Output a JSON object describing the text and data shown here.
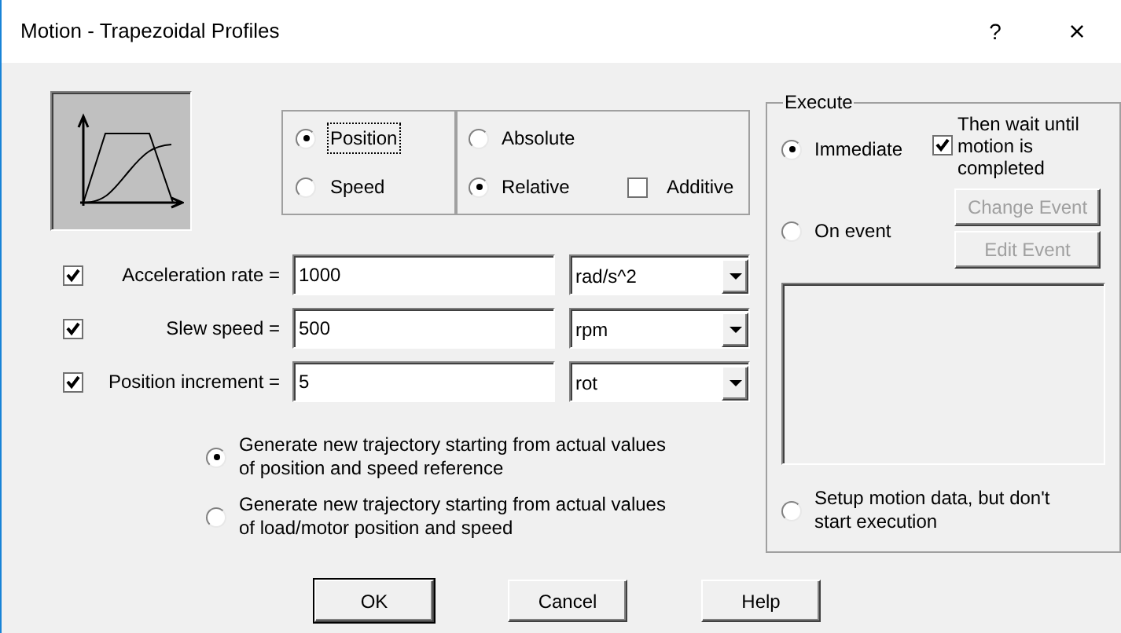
{
  "window": {
    "title": "Motion - Trapezoidal Profiles",
    "controls": [
      "?",
      "×"
    ]
  },
  "mode_options": [
    {
      "label": "Position",
      "selected": true,
      "focused": true
    },
    {
      "label": "Speed",
      "selected": false,
      "focused": false
    }
  ],
  "reference_options": [
    {
      "label": "Absolute",
      "selected": false
    },
    {
      "label": "Relative",
      "selected": true
    }
  ],
  "additive": {
    "label": "Additive",
    "checked": false
  },
  "parameters": [
    {
      "checked": true,
      "label": "Acceleration rate =",
      "value": "1000",
      "unit": "rad/s^2"
    },
    {
      "checked": true,
      "label": "Slew speed =",
      "value": "500",
      "unit": "rpm"
    },
    {
      "checked": true,
      "label": "Position increment =",
      "value": "5",
      "unit": "rot"
    }
  ],
  "trajectory_options": [
    {
      "label": "Generate new trajectory starting from actual values of position and speed reference",
      "selected": true
    },
    {
      "label": "Generate new trajectory starting from actual values of load/motor position and speed",
      "selected": false
    }
  ],
  "execute": {
    "title": "Execute",
    "immediate": {
      "label": "Immediate",
      "selected": true
    },
    "wait": {
      "label": "Then wait until motion is completed",
      "checked": true
    },
    "on_event": {
      "label": "On event",
      "selected": false
    },
    "event_buttons": [
      {
        "label": "Change Event",
        "disabled": true
      },
      {
        "label": "Edit Event",
        "disabled": true
      }
    ],
    "setup_only": {
      "label": "Setup motion data, but don't start execution",
      "selected": false
    }
  },
  "buttons": [
    {
      "label": "OK",
      "default": true
    },
    {
      "label": "Cancel",
      "default": false
    },
    {
      "label": "Help",
      "default": false
    }
  ]
}
